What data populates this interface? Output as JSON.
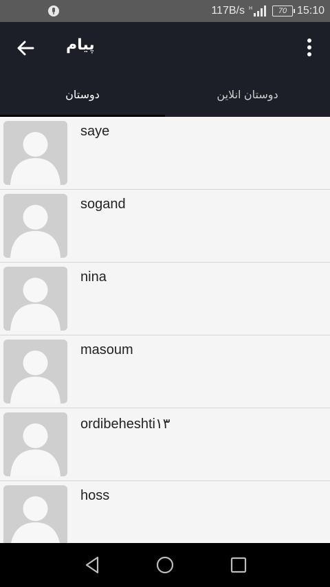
{
  "status_bar": {
    "net_speed": "117B/s",
    "battery": "70",
    "time": "15:10"
  },
  "app_bar": {
    "title": "پیام",
    "back_icon": "arrow-left-icon",
    "more_icon": "more-vert-icon"
  },
  "tabs": [
    {
      "label": "دوستان",
      "active": true
    },
    {
      "label": "دوستان انلاین",
      "active": false
    }
  ],
  "contacts": [
    {
      "name": "saye"
    },
    {
      "name": "sogand"
    },
    {
      "name": "nina"
    },
    {
      "name": "masoum"
    },
    {
      "name": "ordibeheshti۱۳"
    },
    {
      "name": "hoss"
    }
  ],
  "colors": {
    "app_bar": "#1c1f28",
    "status_bar": "#5a5a5a",
    "list_bg": "#f5f5f5"
  }
}
